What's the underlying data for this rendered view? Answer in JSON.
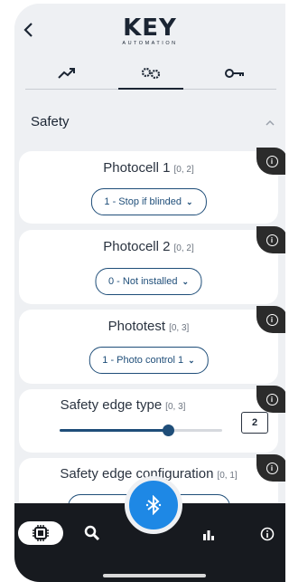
{
  "header": {
    "back_icon": "chevron-left-icon",
    "logo_main": "KEY",
    "logo_sub": "AUTOMATION",
    "tabs": [
      {
        "icon": "trend-chart-icon",
        "active": false
      },
      {
        "icon": "gears-icon",
        "active": true
      },
      {
        "icon": "key-icon",
        "active": false
      }
    ]
  },
  "section": {
    "title": "Safety",
    "expanded": true
  },
  "params": [
    {
      "name": "Photocell 1",
      "range": "[0, 2]",
      "value": "1 - Stop if blinded"
    },
    {
      "name": "Photocell 2",
      "range": "[0, 2]",
      "value": "0 - Not installed"
    },
    {
      "name": "Phototest",
      "range": "[0, 3]",
      "value": "1 - Photo control 1"
    },
    {
      "name": "Safety edge type",
      "range": "[0, 3]",
      "value": "2",
      "slider_fraction": 0.667
    },
    {
      "name": "Safety edge configuration",
      "range": "[0, 1]"
    }
  ],
  "bottom_nav": {
    "items": [
      "chip-icon",
      "wrench-search-icon",
      "bar-chart-icon",
      "info-icon"
    ],
    "active": "chip-icon",
    "center": "bluetooth-icon"
  },
  "colors": {
    "accent": "#1f4e79",
    "bluetooth": "#1e88e5",
    "bar": "#171a1f",
    "badge": "#2b2b2b"
  }
}
